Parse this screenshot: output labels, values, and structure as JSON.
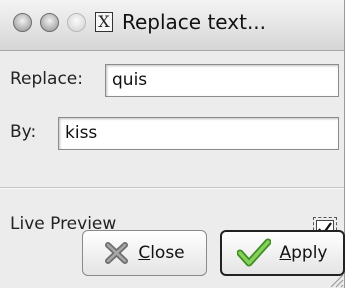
{
  "window": {
    "title": "Replace text...",
    "x11_glyph": "X"
  },
  "form": {
    "replace_label": "Replace:",
    "replace_value": "quis",
    "by_label": "By:",
    "by_value": "kiss"
  },
  "live_preview": {
    "label": "Live Preview",
    "checked": true
  },
  "buttons": {
    "close_label": "Close",
    "close_mnemonic": "C",
    "apply_label": "Apply",
    "apply_mnemonic": "A"
  },
  "colors": {
    "window_bg": "#ececec",
    "apply_check_green": "#5db336",
    "close_x_gray": "#7a7a7a"
  }
}
